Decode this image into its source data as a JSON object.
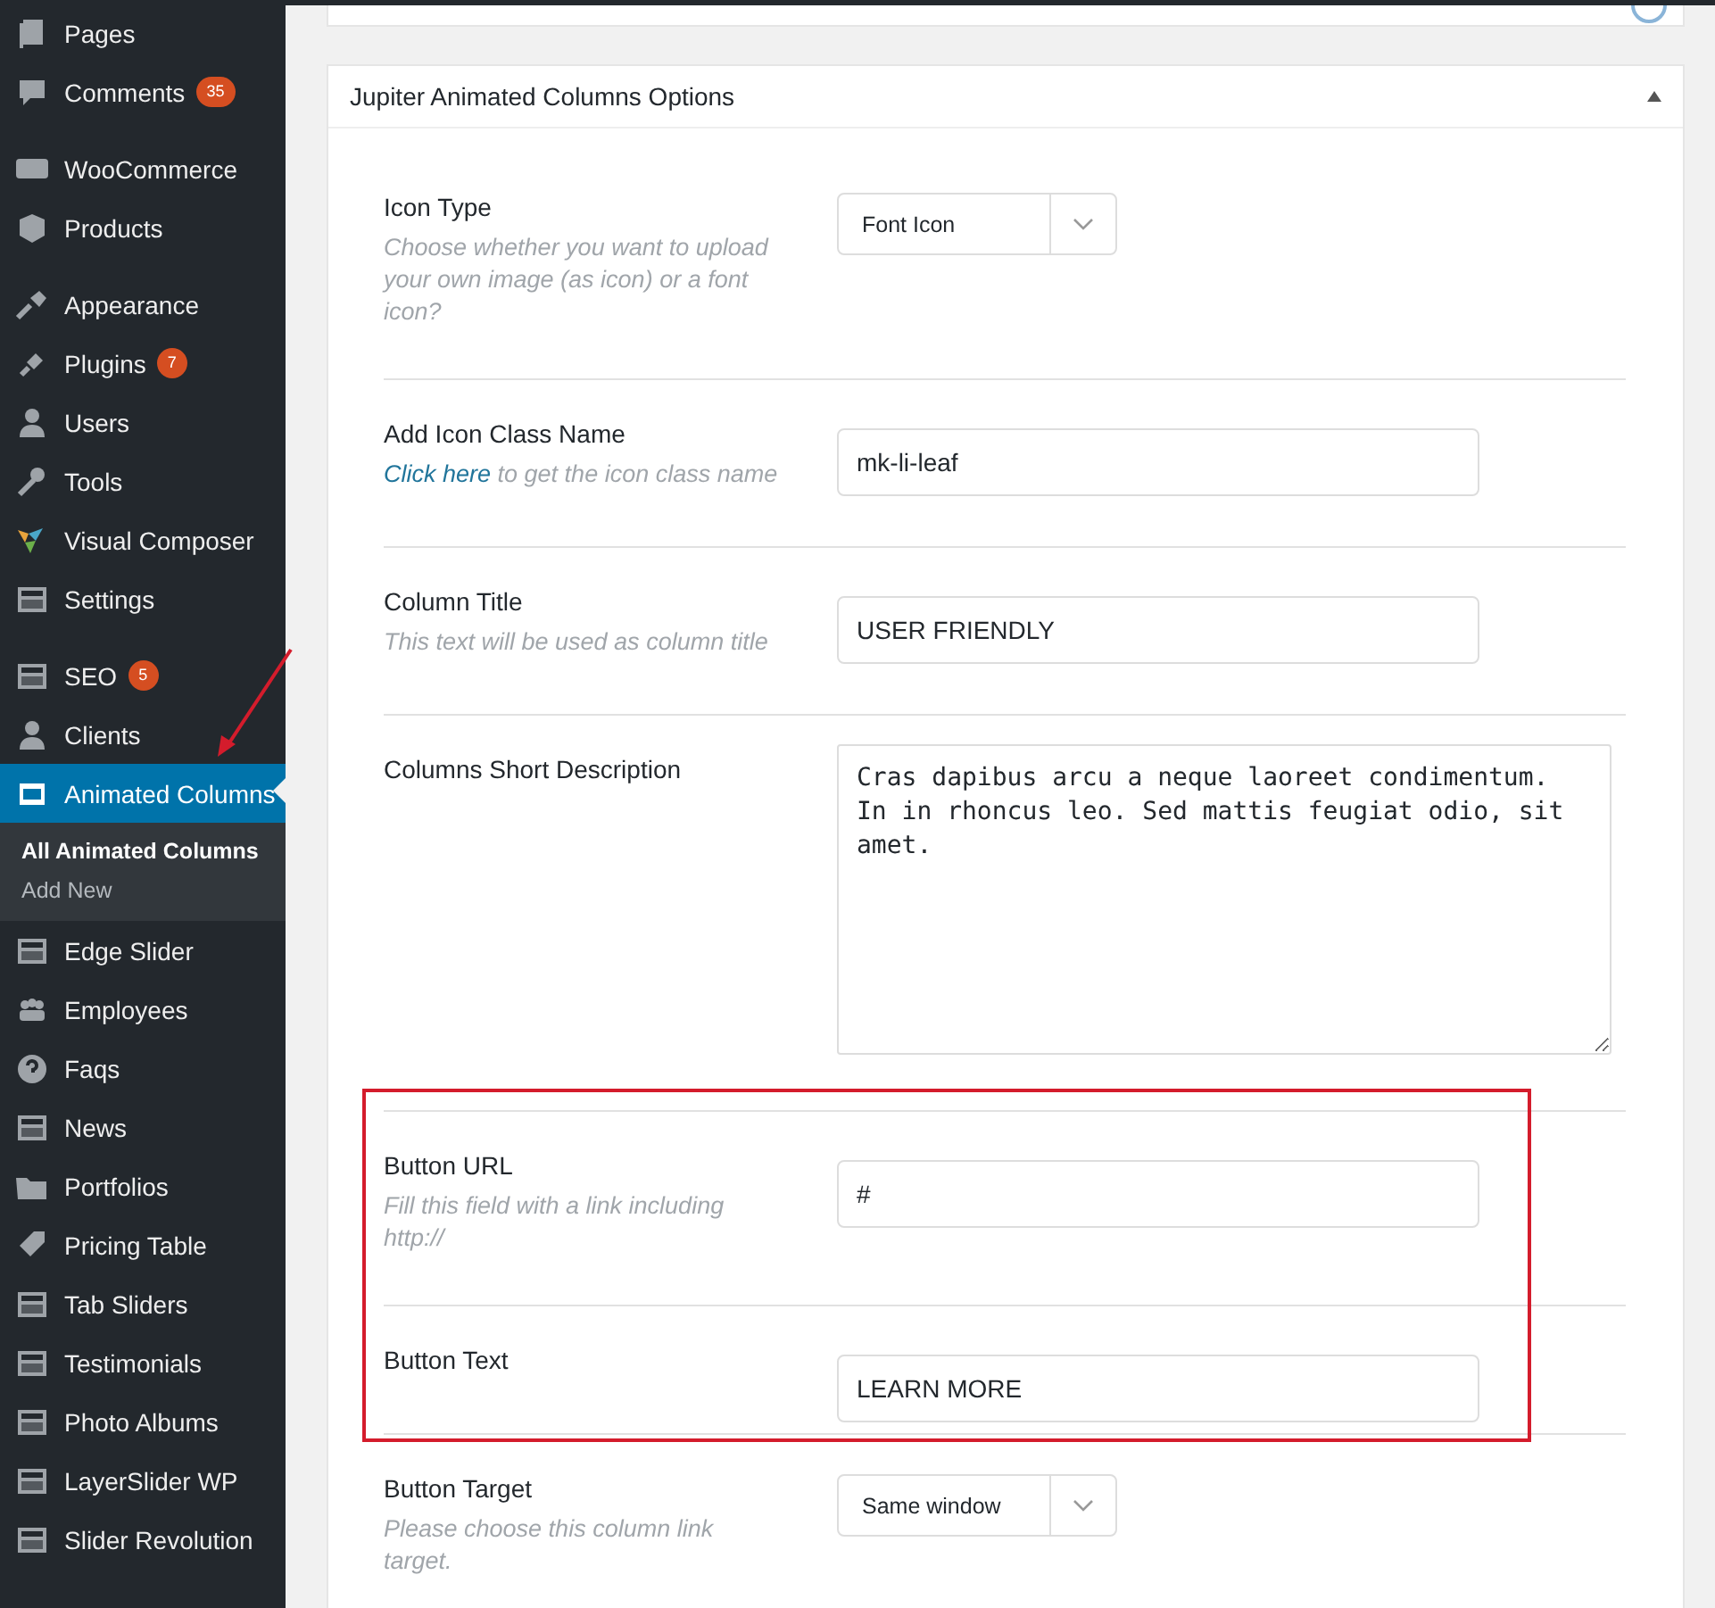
{
  "sidebar": {
    "groups": [
      [
        {
          "label": "Pages",
          "selected": false
        },
        {
          "label": "Comments",
          "badge": "35",
          "selected": false
        }
      ],
      [
        {
          "label": "WooCommerce",
          "selected": false
        },
        {
          "label": "Products",
          "selected": false
        }
      ],
      [
        {
          "label": "Appearance",
          "selected": false
        },
        {
          "label": "Plugins",
          "badge": "7",
          "selected": false
        },
        {
          "label": "Users",
          "selected": false
        },
        {
          "label": "Tools",
          "selected": false
        },
        {
          "label": "Visual Composer",
          "selected": false
        },
        {
          "label": "Settings",
          "selected": false
        }
      ],
      [
        {
          "label": "SEO",
          "badge": "5",
          "selected": false
        },
        {
          "label": "Clients",
          "selected": false
        },
        {
          "label": "Animated Columns",
          "selected": true,
          "children": [
            {
              "label": "All Animated Columns",
              "selected": true
            },
            {
              "label": "Add New",
              "selected": false
            }
          ]
        },
        {
          "label": "Edge Slider",
          "selected": false
        },
        {
          "label": "Employees",
          "selected": false
        },
        {
          "label": "Faqs",
          "selected": false
        },
        {
          "label": "News",
          "selected": false
        },
        {
          "label": "Portfolios",
          "selected": false
        },
        {
          "label": "Pricing Table",
          "selected": false
        },
        {
          "label": "Tab Sliders",
          "selected": false
        },
        {
          "label": "Testimonials",
          "selected": false
        },
        {
          "label": "Photo Albums",
          "selected": false
        },
        {
          "label": "LayerSlider WP",
          "selected": false
        },
        {
          "label": "Slider Revolution",
          "selected": false
        }
      ]
    ]
  },
  "panel": {
    "title": "Jupiter Animated Columns Options",
    "expanded": true,
    "fields": [
      {
        "kind": "select",
        "label": "Icon Type",
        "description": "Choose whether you want to upload your own image (as icon) or a font icon?",
        "value": "Font Icon"
      },
      {
        "kind": "text",
        "label": "Add Icon Class Name",
        "description_link": "Click here",
        "description": " to get the icon class name",
        "value": "mk-li-leaf"
      },
      {
        "kind": "text",
        "label": "Column Title",
        "description": "This text will be used as column title",
        "value": "USER FRIENDLY"
      },
      {
        "kind": "textarea",
        "label": "Columns Short Description",
        "value": "Cras dapibus arcu a neque laoreet condimentum. In in rhoncus leo. Sed mattis feugiat odio, sit amet."
      },
      {
        "kind": "text",
        "label": "Button URL",
        "description": "Fill this field with a link including http://",
        "value": "#"
      },
      {
        "kind": "text",
        "label": "Button Text",
        "value": "LEARN MORE"
      },
      {
        "kind": "select",
        "label": "Button Target",
        "description": "Please choose this column link target.",
        "value": "Same window"
      }
    ]
  }
}
